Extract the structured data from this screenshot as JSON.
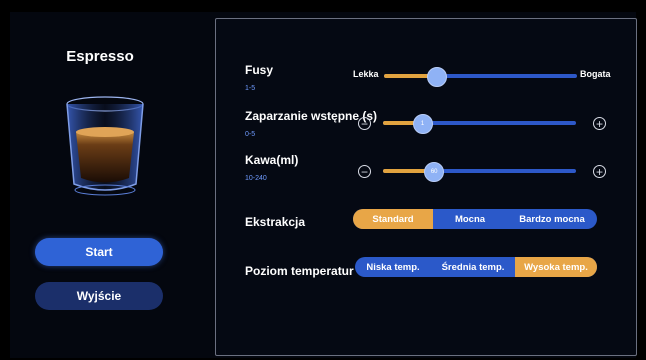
{
  "drink": {
    "title": "Espresso"
  },
  "buttons": {
    "start": "Start",
    "exit": "Wyjście"
  },
  "settings": {
    "grounds": {
      "label": "Fusy",
      "range": "1-5",
      "min_label": "Lekka",
      "max_label": "Bogata",
      "level_fraction": 0.27
    },
    "preinfusion": {
      "label": "Zaparzanie wstępne (s)",
      "range": "0-5",
      "knob_text": "1",
      "level_fraction": 0.2
    },
    "coffee": {
      "label": "Kawa(ml)",
      "range": "10-240",
      "knob_text": "60",
      "level_fraction": 0.26
    }
  },
  "extraction": {
    "label": "Ekstrakcja",
    "options": [
      "Standard",
      "Mocna",
      "Bardzo mocna"
    ],
    "selected": "Standard"
  },
  "temperature": {
    "label": "Poziom temperatur",
    "options": [
      "Niska temp.",
      "Średnia temp.",
      "Wysoka temp."
    ],
    "selected": "Wysoka temp."
  },
  "colors": {
    "accent": "#e2a33f",
    "primary": "#2d58c8",
    "background": "#04070f"
  },
  "icons": {
    "minus": "minus-circle-icon",
    "plus": "plus-circle-icon"
  }
}
